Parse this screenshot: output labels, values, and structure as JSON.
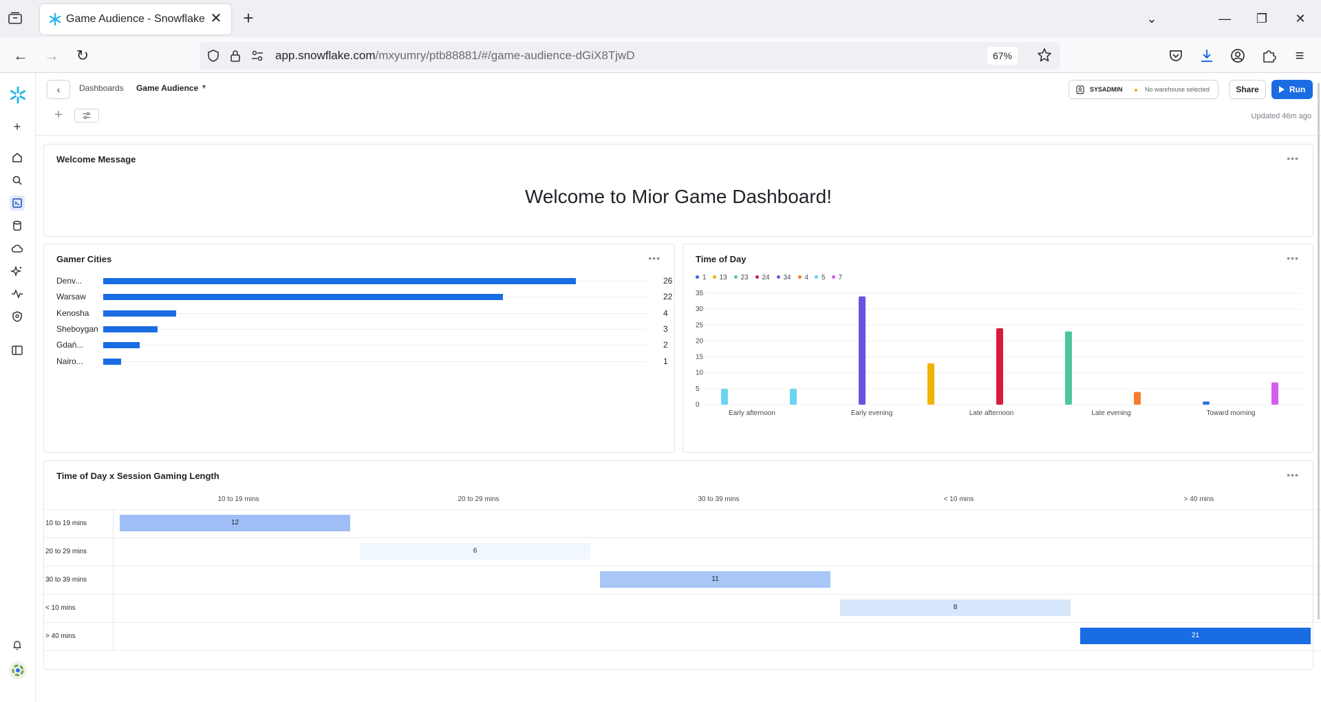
{
  "browser": {
    "tab_title": "Game Audience - Snowflake",
    "url_domain": "app.snowflake.com",
    "url_path": "/mxyumry/ptb88881/#/game-audience-dGiX8TjwD",
    "zoom": "67%"
  },
  "header": {
    "breadcrumb_parent": "Dashboards",
    "breadcrumb_current": "Game Audience",
    "role": "SYSADMIN",
    "warehouse": "No warehouse selected",
    "share_label": "Share",
    "run_label": "Run",
    "updated": "Updated 46m ago"
  },
  "tiles": {
    "welcome": {
      "title": "Welcome Message",
      "message": "Welcome to Mior Game Dashboard!"
    },
    "cities": {
      "title": "Gamer Cities"
    },
    "time_of_day": {
      "title": "Time of Day"
    },
    "heatmap": {
      "title": "Time of Day x Session Gaming Length"
    }
  },
  "chart_data": [
    {
      "type": "bar",
      "orientation": "horizontal",
      "categories": [
        "Denv...",
        "Warsaw",
        "Kenosha",
        "Sheboygan",
        "Gdań...",
        "Nairo..."
      ],
      "values": [
        26,
        22,
        4,
        3,
        2,
        1
      ],
      "colors": {
        "bar": "#1a6ce3"
      }
    },
    {
      "type": "bar",
      "x_categories": [
        "Early afternoon",
        "Early evening",
        "Late afternoon",
        "Late evening",
        "Toward morning"
      ],
      "y_ticks": [
        0,
        5,
        10,
        15,
        20,
        25,
        30,
        35
      ],
      "ylim": [
        0,
        35
      ],
      "legend": [
        {
          "name": "1",
          "color": "#2f6fe0"
        },
        {
          "name": "13",
          "color": "#f0b400"
        },
        {
          "name": "23",
          "color": "#4cc79a"
        },
        {
          "name": "24",
          "color": "#d81b3c"
        },
        {
          "name": "34",
          "color": "#6c52e0"
        },
        {
          "name": "4",
          "color": "#f57c2a"
        },
        {
          "name": "5",
          "color": "#6ad3f0"
        },
        {
          "name": "7",
          "color": "#d45cf0"
        }
      ],
      "legend_position": "top-left",
      "bars": [
        {
          "value": 5,
          "color": "#6ad3f0"
        },
        {
          "value": 5,
          "color": "#6ad3f0"
        },
        {
          "value": 34,
          "color": "#6c52e0"
        },
        {
          "value": 13,
          "color": "#f0b400"
        },
        {
          "value": 24,
          "color": "#d81b3c"
        },
        {
          "value": 23,
          "color": "#4cc79a"
        },
        {
          "value": 4,
          "color": "#f57c2a"
        },
        {
          "value": 1,
          "color": "#2f6fe0"
        },
        {
          "value": 7,
          "color": "#d45cf0"
        }
      ]
    },
    {
      "type": "heatmap",
      "columns": [
        "10 to 19 mins",
        "20 to 29 mins",
        "30 to 39 mins",
        "< 10 mins",
        "> 40 mins"
      ],
      "rows": [
        "10 to 19 mins",
        "20 to 29 mins",
        "30 to 39 mins",
        "< 10 mins",
        "> 40 mins"
      ],
      "cells": [
        {
          "row": 0,
          "col": 0,
          "value": 12,
          "color": "#9ebef5"
        },
        {
          "row": 1,
          "col": 1,
          "value": 6,
          "color": "#f1f7fe"
        },
        {
          "row": 2,
          "col": 2,
          "value": 11,
          "color": "#a8c6f6"
        },
        {
          "row": 3,
          "col": 3,
          "value": 8,
          "color": "#d8e6fc"
        },
        {
          "row": 4,
          "col": 4,
          "value": 21,
          "color": "#1a6ce3"
        }
      ]
    }
  ]
}
